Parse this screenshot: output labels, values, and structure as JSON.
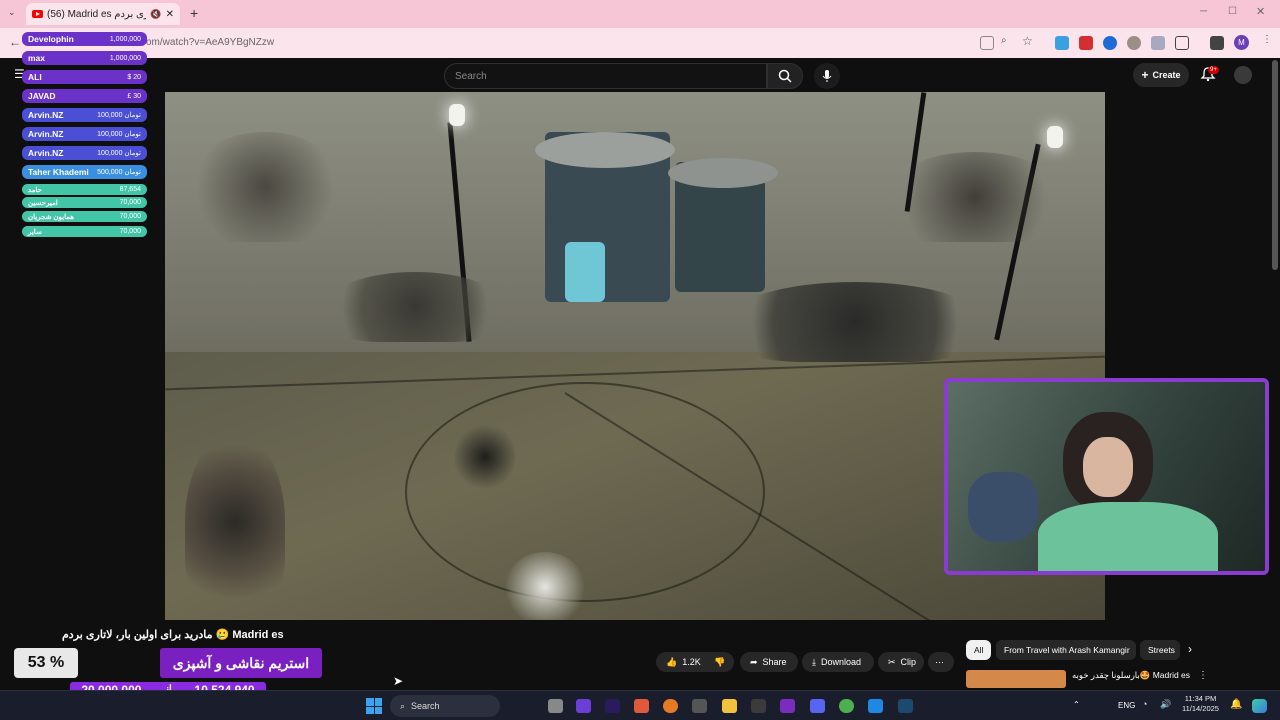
{
  "browser": {
    "tab_title": "(56) Madrid es لاتاری بردم",
    "url": "om/watch?v=AeA9YBgNZzw"
  },
  "youtube": {
    "search_placeholder": "Search",
    "create_label": "Create",
    "notification_count": "9+",
    "avatar_letter": "M",
    "video_title": "مادرید برای اولین بار، لاتاری بردم 🥲 Madrid es",
    "like_count": "1.2K",
    "share_label": "Share",
    "download_label": "Download",
    "clip_label": "Clip",
    "chips": [
      "All",
      "From Travel with Arash Kamangir",
      "Streets"
    ],
    "rec_title": "بارسلونا چقدر خوبه🤩 Madrid es"
  },
  "overlay": {
    "tips": [
      {
        "name": "Develophin",
        "amount": "1,000,000"
      },
      {
        "name": "max",
        "amount": "1,000,000"
      },
      {
        "name": "ALI",
        "amount": "$ 20"
      },
      {
        "name": "JAVAD",
        "amount": "£ 30"
      },
      {
        "name": "Arvin.NZ",
        "amount": "100,000 تومان"
      },
      {
        "name": "Arvin.NZ",
        "amount": "100,000 تومان"
      },
      {
        "name": "Arvin.NZ",
        "amount": "100,000 تومان"
      },
      {
        "name": "Taher Khademi",
        "amount": "500,000 تومان"
      },
      {
        "name": "حامد",
        "amount": "87,654"
      },
      {
        "name": "امیرحسین",
        "amount": "70,000"
      },
      {
        "name": "همایون شجریان",
        "amount": "70,000"
      },
      {
        "name": "سایر",
        "amount": "70,000"
      }
    ],
    "tip_colors": [
      "#6a32c8",
      "#6a32c8",
      "#6a32c8",
      "#6a32c8",
      "#4b4fd6",
      "#4b4fd6",
      "#4b4fd6",
      "#3b8fe0",
      "#43c6a8",
      "#43c6a8",
      "#43c6a8",
      "#43c6a8"
    ],
    "donation_percent": "53 %",
    "donation_banner": "استریم نقاشی و آشپزی",
    "donation_goal": "20,000,000",
    "donation_from": "از",
    "donation_raised": "10,524,940"
  },
  "taskbar": {
    "search_label": "Search",
    "lang": "ENG",
    "time": "11:34 PM",
    "date": "11/14/2025"
  }
}
